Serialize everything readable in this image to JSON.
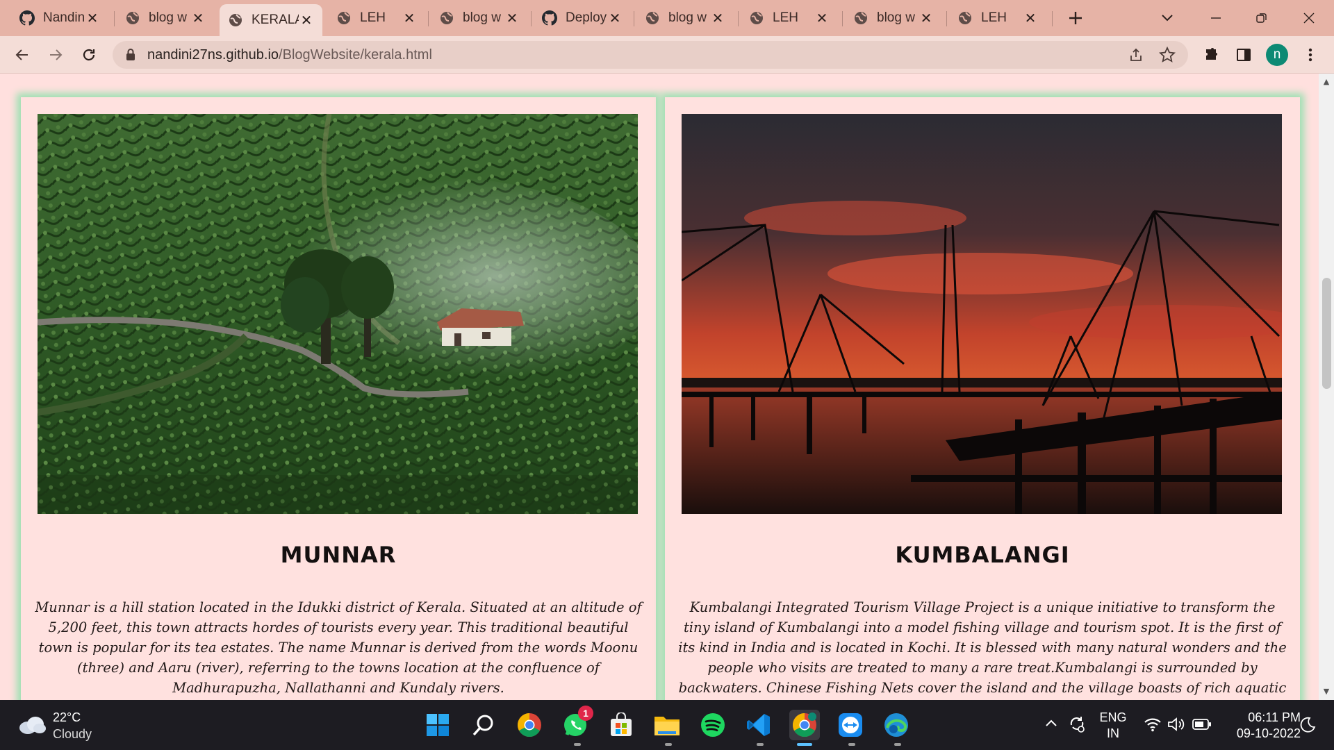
{
  "browser": {
    "tabs": [
      {
        "title": "Nandini",
        "icon": "github-icon"
      },
      {
        "title": "blog w",
        "icon": "globe-icon"
      },
      {
        "title": "KERALA",
        "icon": "globe-icon",
        "active": true
      },
      {
        "title": "LEH",
        "icon": "globe-icon"
      },
      {
        "title": "blog w",
        "icon": "globe-icon"
      },
      {
        "title": "Deploy",
        "icon": "github-icon"
      },
      {
        "title": "blog w",
        "icon": "globe-icon"
      },
      {
        "title": "LEH",
        "icon": "globe-icon"
      },
      {
        "title": "blog w",
        "icon": "globe-icon"
      },
      {
        "title": "LEH",
        "icon": "globe-icon"
      }
    ],
    "url_host": "nandini27ns.github.io",
    "url_path": "/BlogWebsite/kerala.html",
    "profile_initial": "n"
  },
  "page": {
    "cards": [
      {
        "title": "MUNNAR",
        "text": "Munnar is a hill station located in the Idukki district of Kerala. Situated at an altitude of 5,200 feet, this town attracts hordes of tourists every year. This traditional beautiful town is popular for its tea estates. The name Munnar is derived from the words Moonu (three) and Aaru (river), referring to the towns location at the confluence of Madhurapuzha, Nallathanni and Kundaly rivers."
      },
      {
        "title": "KUMBALANGI",
        "text": "Kumbalangi Integrated Tourism Village Project is a unique initiative to transform the tiny island of Kumbalangi into a model fishing village and tourism spot. It is the first of its kind in India and is located in Kochi. It is blessed with many natural wonders and the people who visits are treated to many a rare treat.Kumbalangi is surrounded by backwaters. Chinese Fishing Nets cover the island and the village boasts of rich aquatic life."
      }
    ]
  },
  "taskbar": {
    "weather_temp": "22°C",
    "weather_desc": "Cloudy",
    "whatsapp_badge": "1",
    "lang_primary": "ENG",
    "lang_secondary": "IN",
    "time": "06:11 PM",
    "date": "09-10-2022"
  },
  "colors": {
    "tab_strip": "#e6b3a6",
    "toolbar": "#f4ddd7",
    "page_bg": "#ffe0de",
    "card_glow": "#9fe0b3",
    "taskbar": "#1d1c22"
  }
}
